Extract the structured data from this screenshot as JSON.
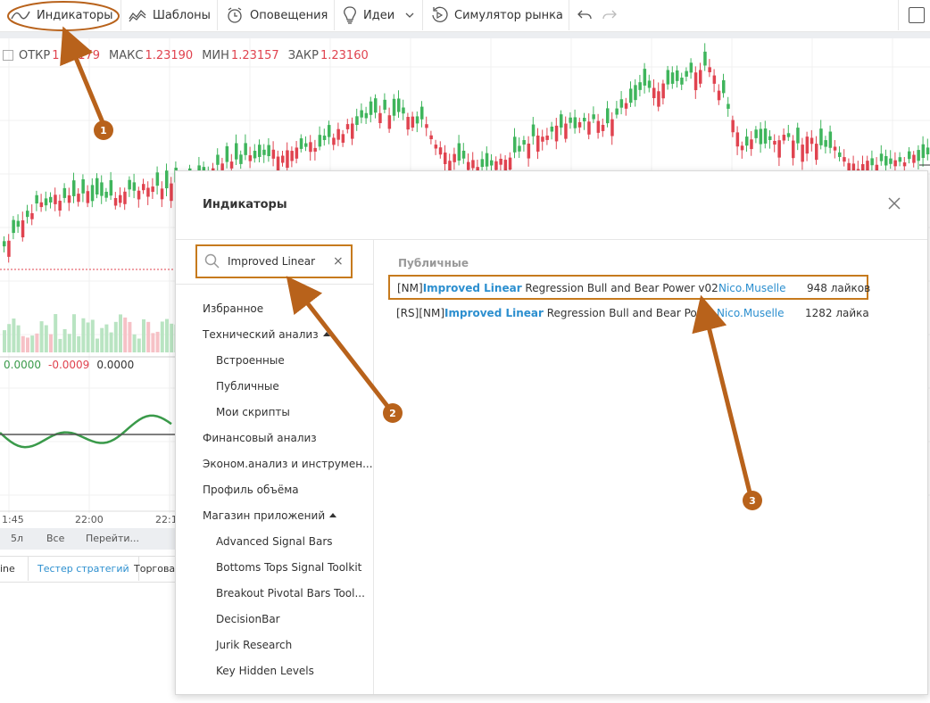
{
  "toolbar": {
    "indicators": "Индикаторы",
    "templates": "Шаблоны",
    "alerts": "Оповещения",
    "ideas": "Идеи",
    "replay": "Симулятор рынка"
  },
  "ohlc": {
    "open_label": "ОТКР",
    "open_value": "1.23179",
    "high_label": "МАКС",
    "high_value": "1.23190",
    "low_label": "МИН",
    "low_value": "1.23157",
    "close_label": "ЗАКР",
    "close_value": "1.23160"
  },
  "oscillator_values": [
    "0.0000",
    "-0.0009",
    "0.0000"
  ],
  "time_axis": [
    "1:45",
    "22:00",
    "22:1"
  ],
  "range_bar": [
    "5л",
    "Все",
    "Перейти..."
  ],
  "bottom_tabs": [
    "ine",
    "Тестер стратегий",
    "Торговая"
  ],
  "dialog": {
    "title": "Индикаторы",
    "search_value": "Improved Linear",
    "section_label": "Публичные",
    "categories": [
      {
        "label": "Избранное",
        "level": "top"
      },
      {
        "label": "Технический анализ",
        "level": "top",
        "expanded": true
      },
      {
        "label": "Встроенные",
        "level": "sub"
      },
      {
        "label": "Публичные",
        "level": "sub"
      },
      {
        "label": "Мои скрипты",
        "level": "sub"
      },
      {
        "label": "Финансовый анализ",
        "level": "top"
      },
      {
        "label": "Эконом.анализ и инструмен...",
        "level": "top"
      },
      {
        "label": "Профиль объёма",
        "level": "top"
      },
      {
        "label": "Магазин приложений",
        "level": "top",
        "expanded": true
      },
      {
        "label": "Advanced Signal Bars",
        "level": "sub"
      },
      {
        "label": "Bottoms Tops Signal Toolkit",
        "level": "sub"
      },
      {
        "label": "Breakout Pivotal Bars Tool...",
        "level": "sub"
      },
      {
        "label": "DecisionBar",
        "level": "sub"
      },
      {
        "label": "Jurik Research",
        "level": "sub"
      },
      {
        "label": "Key Hidden Levels",
        "level": "sub"
      }
    ],
    "results": [
      {
        "prefix": "[NM]",
        "match": "Improved Linear",
        "rest": " Regression Bull and Bear Power v02",
        "author": "Nico.Muselle",
        "likes": "948 лайков",
        "highlighted": true
      },
      {
        "prefix": "[RS][NM]",
        "match": "Improved Linear",
        "rest": " Regression Bull and Bear Pow...",
        "author": "Nico.Muselle",
        "likes": "1282 лайка",
        "highlighted": false
      }
    ]
  },
  "annotations": [
    "1",
    "2",
    "3"
  ],
  "colors": {
    "up": "#3fb55c",
    "down": "#e0434f",
    "accent": "#c67a1d",
    "link": "#2c8fcf"
  }
}
